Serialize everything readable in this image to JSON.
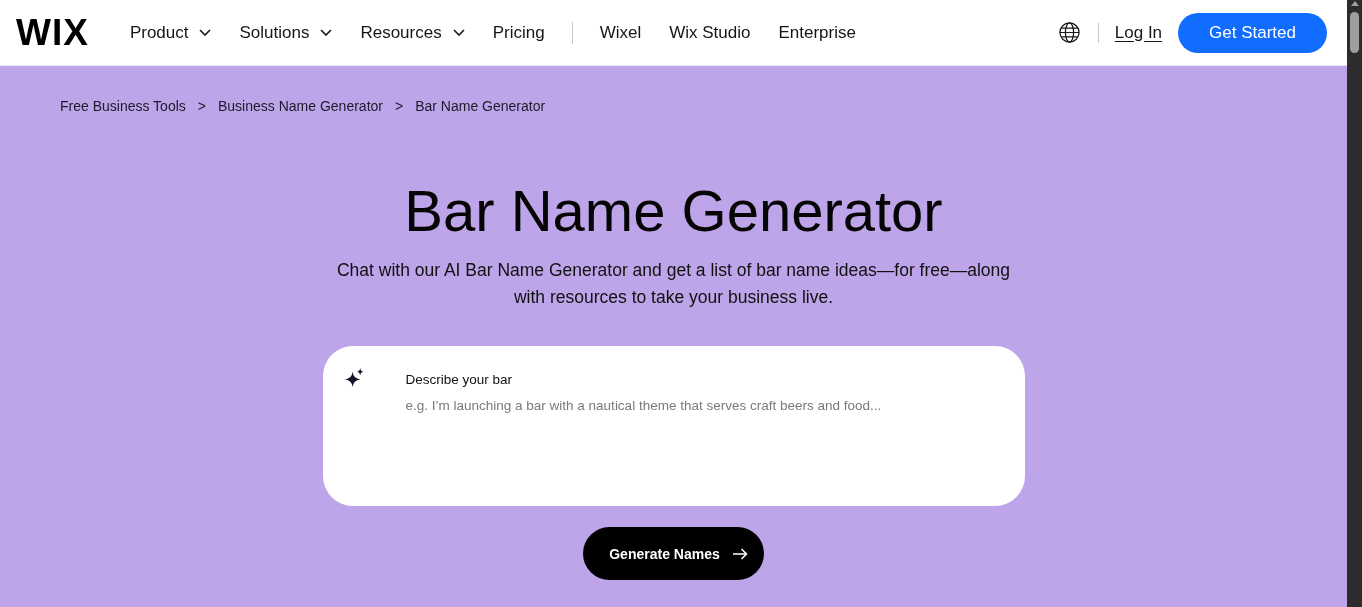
{
  "header": {
    "logo": "WIX",
    "nav": [
      {
        "label": "Product",
        "kind": "dropdown"
      },
      {
        "label": "Solutions",
        "kind": "dropdown"
      },
      {
        "label": "Resources",
        "kind": "dropdown"
      },
      {
        "label": "Pricing",
        "kind": "link"
      }
    ],
    "nav_secondary": [
      "Wixel",
      "Wix Studio",
      "Enterprise"
    ],
    "login": "Log In",
    "cta": "Get Started"
  },
  "breadcrumb": [
    {
      "label": "Free Business Tools",
      "separator": ">"
    },
    {
      "label": "Business Name Generator",
      "separator": ">"
    },
    {
      "label": "Bar Name Generator"
    }
  ],
  "hero": {
    "title": "Bar Name Generator",
    "subtitle": "Chat with our AI Bar Name Generator and get a list of bar name ideas—for free—along with resources to take your business live."
  },
  "prompt": {
    "label": "Describe your bar",
    "placeholder": "e.g. I’m launching a bar with a nautical theme that serves craft beers and food..."
  },
  "submit": {
    "label": "Generate Names"
  }
}
